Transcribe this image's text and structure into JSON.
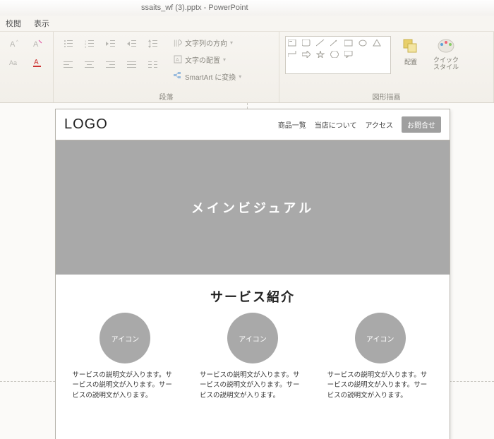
{
  "app": {
    "title": "ssaits_wf (3).pptx - PowerPoint"
  },
  "menu": {
    "review": "校閲",
    "view": "表示"
  },
  "ribbon": {
    "group_font_label": "",
    "group_para_label": "段落",
    "group_draw_label": "図形描画",
    "text_direction": "文字列の方向",
    "text_align": "文字の配置",
    "smartart": "SmartArt に変換",
    "arrange": "配置",
    "quickstyle": "クイック\nスタイル"
  },
  "slide": {
    "logo": "LOGO",
    "nav": {
      "products": "商品一覧",
      "about": "当店について",
      "access": "アクセス",
      "contact": "お問合せ"
    },
    "hero": "メインビジュアル",
    "section_title": "サービス紹介",
    "card_icon_label": "アイコン",
    "card_desc": "サービスの説明文が入ります。サービスの説明文が入ります。サービスの説明文が入ります。"
  }
}
